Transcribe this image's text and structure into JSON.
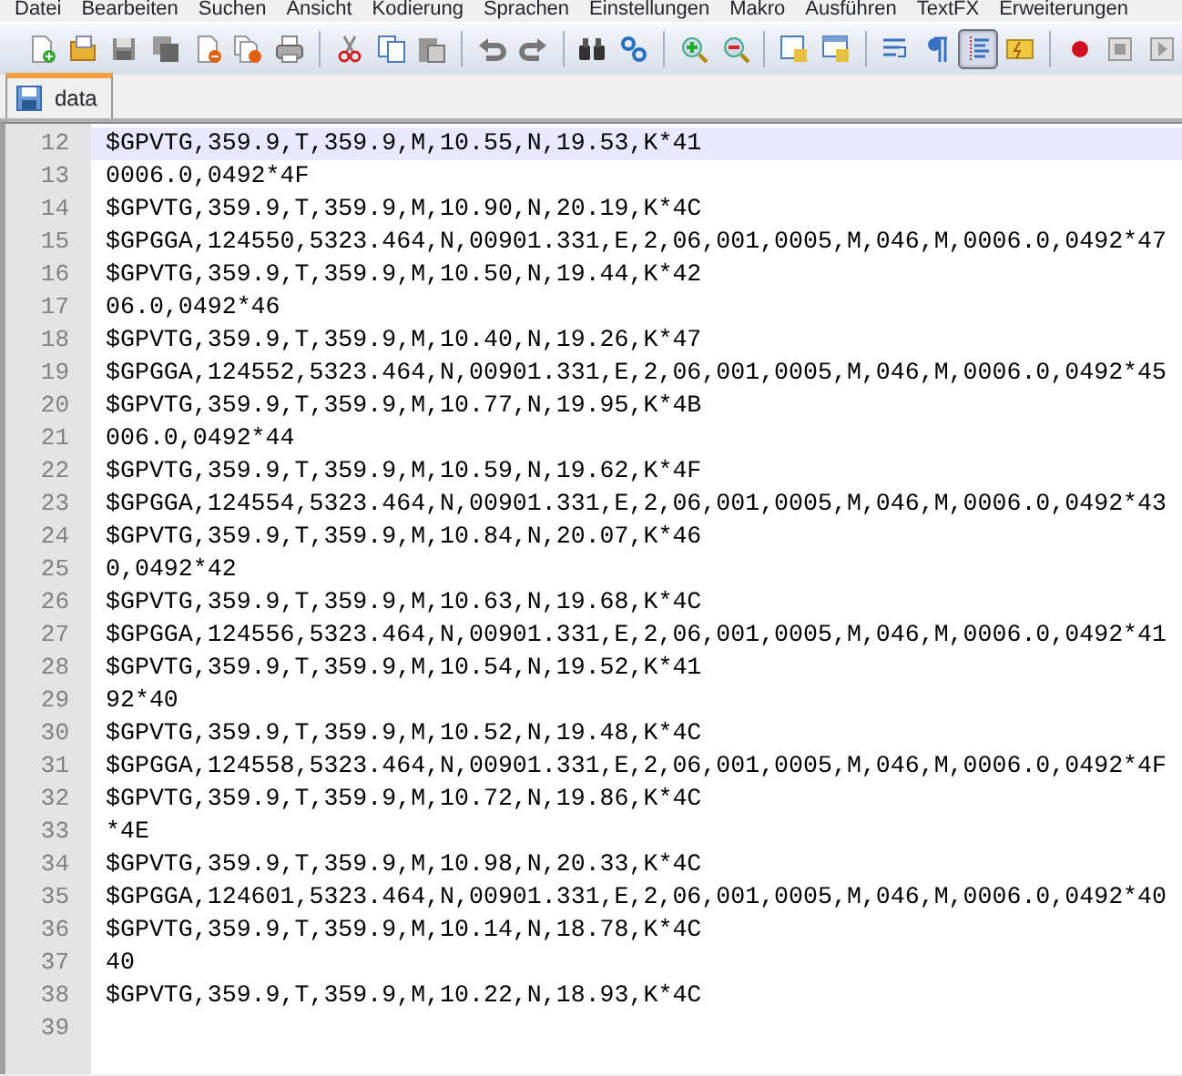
{
  "menu": [
    "Datei",
    "Bearbeiten",
    "Suchen",
    "Ansicht",
    "Kodierung",
    "Sprachen",
    "Einstellungen",
    "Makro",
    "Ausführen",
    "TextFX",
    "Erweiterungen"
  ],
  "toolbar": [
    {
      "selected": false
    },
    {
      "selected": false
    },
    {
      "selected": false
    },
    {
      "selected": false
    },
    {
      "selected": false
    },
    {
      "selected": false
    },
    {
      "selected": false
    },
    {
      "selected": false
    },
    {
      "selected": false
    },
    {
      "selected": false
    },
    {
      "selected": false
    },
    {
      "selected": false
    },
    {
      "selected": false
    },
    {
      "selected": false
    },
    {
      "selected": false
    },
    {
      "selected": false
    },
    {
      "selected": false
    },
    {
      "selected": false
    },
    {
      "selected": false
    },
    {
      "selected": false
    },
    {
      "selected": true
    },
    {
      "selected": false
    },
    {
      "selected": false
    },
    {
      "selected": false
    },
    {
      "selected": false
    }
  ],
  "tabs": [
    {
      "label": "data",
      "selected": true
    }
  ],
  "lines": [
    {
      "number": "12",
      "text": "$GPVTG,359.9,T,359.9,M,10.55,N,19.53,K*41",
      "current": true
    },
    {
      "number": "13",
      "text": "0006.0,0492*4F",
      "current": false
    },
    {
      "number": "14",
      "text": "$GPVTG,359.9,T,359.9,M,10.90,N,20.19,K*4C",
      "current": false
    },
    {
      "number": "15",
      "text": "$GPGGA,124550,5323.464,N,00901.331,E,2,06,001,0005,M,046,M,0006.0,0492*47",
      "current": false
    },
    {
      "number": "16",
      "text": "$GPVTG,359.9,T,359.9,M,10.50,N,19.44,K*42",
      "current": false
    },
    {
      "number": "17",
      "text": "06.0,0492*46",
      "current": false
    },
    {
      "number": "18",
      "text": "$GPVTG,359.9,T,359.9,M,10.40,N,19.26,K*47",
      "current": false
    },
    {
      "number": "19",
      "text": "$GPGGA,124552,5323.464,N,00901.331,E,2,06,001,0005,M,046,M,0006.0,0492*45",
      "current": false
    },
    {
      "number": "20",
      "text": "$GPVTG,359.9,T,359.9,M,10.77,N,19.95,K*4B",
      "current": false
    },
    {
      "number": "21",
      "text": "006.0,0492*44",
      "current": false
    },
    {
      "number": "22",
      "text": "$GPVTG,359.9,T,359.9,M,10.59,N,19.62,K*4F",
      "current": false
    },
    {
      "number": "23",
      "text": "$GPGGA,124554,5323.464,N,00901.331,E,2,06,001,0005,M,046,M,0006.0,0492*43",
      "current": false
    },
    {
      "number": "24",
      "text": "$GPVTG,359.9,T,359.9,M,10.84,N,20.07,K*46",
      "current": false
    },
    {
      "number": "25",
      "text": "0,0492*42",
      "current": false
    },
    {
      "number": "26",
      "text": "$GPVTG,359.9,T,359.9,M,10.63,N,19.68,K*4C",
      "current": false
    },
    {
      "number": "27",
      "text": "$GPGGA,124556,5323.464,N,00901.331,E,2,06,001,0005,M,046,M,0006.0,0492*41",
      "current": false
    },
    {
      "number": "28",
      "text": "$GPVTG,359.9,T,359.9,M,10.54,N,19.52,K*41",
      "current": false
    },
    {
      "number": "29",
      "text": "92*40",
      "current": false
    },
    {
      "number": "30",
      "text": "$GPVTG,359.9,T,359.9,M,10.52,N,19.48,K*4C",
      "current": false
    },
    {
      "number": "31",
      "text": "$GPGGA,124558,5323.464,N,00901.331,E,2,06,001,0005,M,046,M,0006.0,0492*4F",
      "current": false
    },
    {
      "number": "32",
      "text": "$GPVTG,359.9,T,359.9,M,10.72,N,19.86,K*4C",
      "current": false
    },
    {
      "number": "33",
      "text": "*4E",
      "current": false
    },
    {
      "number": "34",
      "text": "$GPVTG,359.9,T,359.9,M,10.98,N,20.33,K*4C",
      "current": false
    },
    {
      "number": "35",
      "text": "$GPGGA,124601,5323.464,N,00901.331,E,2,06,001,0005,M,046,M,0006.0,0492*40",
      "current": false
    },
    {
      "number": "36",
      "text": "$GPVTG,359.9,T,359.9,M,10.14,N,18.78,K*4C",
      "current": false
    },
    {
      "number": "37",
      "text": "40",
      "current": false
    },
    {
      "number": "38",
      "text": "$GPVTG,359.9,T,359.9,M,10.22,N,18.93,K*4C",
      "current": false
    },
    {
      "number": "39",
      "current": false
    }
  ]
}
